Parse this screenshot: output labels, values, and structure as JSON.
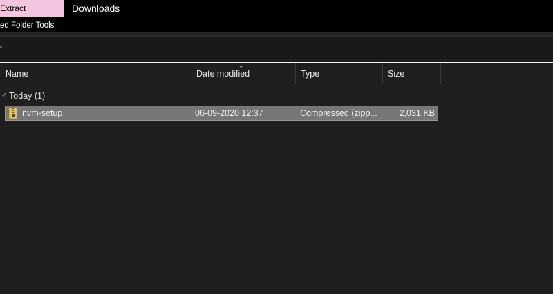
{
  "ribbon": {
    "tab_extract": "Extract",
    "tools_label": "ed Folder Tools"
  },
  "window": {
    "title": "Downloads"
  },
  "columns": {
    "name": "Name",
    "date_modified": "Date modified",
    "type": "Type",
    "size": "Size"
  },
  "group": {
    "label": "Today (1)"
  },
  "files": [
    {
      "name": "nvm-setup",
      "date_modified": "06-09-2020 12:37",
      "type": "Compressed (zipp...",
      "size": "2,031 KB",
      "icon": "zip-folder-icon",
      "selected": true
    }
  ],
  "colors": {
    "extract_tab_bg": "#f5c4e0",
    "background": "#1f1f1f",
    "selection": "#777777"
  }
}
